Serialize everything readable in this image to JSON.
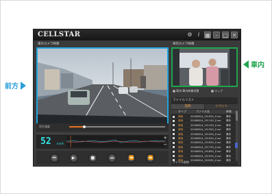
{
  "app": {
    "logo": "CELLSTAR"
  },
  "callouts": {
    "front": "前方",
    "inside": "車内"
  },
  "front_panel": {
    "label": "車外カメラ映像"
  },
  "inside_panel": {
    "label": "車内カメラ映像",
    "options": [
      {
        "label": "車外/車内映像切替"
      },
      {
        "label": "マップ"
      }
    ]
  },
  "timeline": {
    "label": "再生速度",
    "progress": 0.16
  },
  "speed": {
    "value": "52",
    "unit": "km/h"
  },
  "controls": [
    {
      "icon": "skip-back-icon",
      "glyph": "⏮"
    },
    {
      "icon": "play-icon",
      "glyph": "▶"
    },
    {
      "icon": "stop-icon",
      "glyph": "■"
    },
    {
      "icon": "frame-forward-icon",
      "glyph": "⏭"
    },
    {
      "icon": "rewind-icon",
      "glyph": "⏪"
    },
    {
      "icon": "fast-forward-icon",
      "glyph": "⏩"
    }
  ],
  "filelist": {
    "title": "ファイルリスト",
    "tabs": {
      "normal": "常時",
      "event": "イベント"
    },
    "columns": {
      "type": "タイプ",
      "name": "ファイル名",
      "camera": "映像"
    },
    "rows": [
      {
        "type": "常時",
        "name": "20180814_151050_Z.avi",
        "camera": "車外"
      },
      {
        "type": "常時",
        "name": "20180814_151150_Z.avi",
        "camera": "車外"
      },
      {
        "type": "常時",
        "name": "20180814_151250_Z.avi",
        "camera": "車外"
      },
      {
        "type": "常時",
        "name": "20180814_151350_Z.avi",
        "camera": "車外"
      },
      {
        "type": "常時",
        "name": "20180814_151450_Z.avi",
        "camera": "車外"
      },
      {
        "type": "常時",
        "name": "20180814_151550_Z.avi",
        "camera": "車外"
      },
      {
        "type": "常時",
        "name": "20180814_151650_Z.avi",
        "camera": "車外"
      },
      {
        "type": "常時",
        "name": "20180814_151750_Z.avi",
        "camera": "車外"
      },
      {
        "type": "常時",
        "name": "20180814_151850_Z.avi",
        "camera": "車外"
      },
      {
        "type": "常時",
        "name": "20180814_151950_Z.avi",
        "camera": "車外"
      },
      {
        "type": "常時",
        "name": "20180814_152050_Z.avi",
        "camera": "車外"
      }
    ],
    "footer": "ファイル削除"
  },
  "colors": {
    "front_border": "#23a3dd",
    "inside_border": "#1fa54d",
    "accent": "#e8721e",
    "speed": "#35e4e4"
  }
}
